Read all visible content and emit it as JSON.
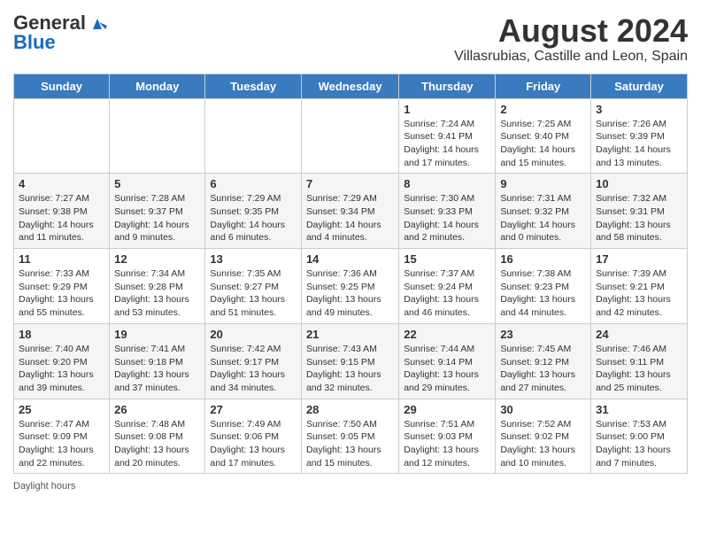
{
  "logo": {
    "general": "General",
    "blue": "Blue"
  },
  "title": "August 2024",
  "subtitle": "Villasrubias, Castille and Leon, Spain",
  "days_of_week": [
    "Sunday",
    "Monday",
    "Tuesday",
    "Wednesday",
    "Thursday",
    "Friday",
    "Saturday"
  ],
  "weeks": [
    [
      {
        "day": "",
        "info": ""
      },
      {
        "day": "",
        "info": ""
      },
      {
        "day": "",
        "info": ""
      },
      {
        "day": "",
        "info": ""
      },
      {
        "day": "1",
        "info": "Sunrise: 7:24 AM\nSunset: 9:41 PM\nDaylight: 14 hours and 17 minutes."
      },
      {
        "day": "2",
        "info": "Sunrise: 7:25 AM\nSunset: 9:40 PM\nDaylight: 14 hours and 15 minutes."
      },
      {
        "day": "3",
        "info": "Sunrise: 7:26 AM\nSunset: 9:39 PM\nDaylight: 14 hours and 13 minutes."
      }
    ],
    [
      {
        "day": "4",
        "info": "Sunrise: 7:27 AM\nSunset: 9:38 PM\nDaylight: 14 hours and 11 minutes."
      },
      {
        "day": "5",
        "info": "Sunrise: 7:28 AM\nSunset: 9:37 PM\nDaylight: 14 hours and 9 minutes."
      },
      {
        "day": "6",
        "info": "Sunrise: 7:29 AM\nSunset: 9:35 PM\nDaylight: 14 hours and 6 minutes."
      },
      {
        "day": "7",
        "info": "Sunrise: 7:29 AM\nSunset: 9:34 PM\nDaylight: 14 hours and 4 minutes."
      },
      {
        "day": "8",
        "info": "Sunrise: 7:30 AM\nSunset: 9:33 PM\nDaylight: 14 hours and 2 minutes."
      },
      {
        "day": "9",
        "info": "Sunrise: 7:31 AM\nSunset: 9:32 PM\nDaylight: 14 hours and 0 minutes."
      },
      {
        "day": "10",
        "info": "Sunrise: 7:32 AM\nSunset: 9:31 PM\nDaylight: 13 hours and 58 minutes."
      }
    ],
    [
      {
        "day": "11",
        "info": "Sunrise: 7:33 AM\nSunset: 9:29 PM\nDaylight: 13 hours and 55 minutes."
      },
      {
        "day": "12",
        "info": "Sunrise: 7:34 AM\nSunset: 9:28 PM\nDaylight: 13 hours and 53 minutes."
      },
      {
        "day": "13",
        "info": "Sunrise: 7:35 AM\nSunset: 9:27 PM\nDaylight: 13 hours and 51 minutes."
      },
      {
        "day": "14",
        "info": "Sunrise: 7:36 AM\nSunset: 9:25 PM\nDaylight: 13 hours and 49 minutes."
      },
      {
        "day": "15",
        "info": "Sunrise: 7:37 AM\nSunset: 9:24 PM\nDaylight: 13 hours and 46 minutes."
      },
      {
        "day": "16",
        "info": "Sunrise: 7:38 AM\nSunset: 9:23 PM\nDaylight: 13 hours and 44 minutes."
      },
      {
        "day": "17",
        "info": "Sunrise: 7:39 AM\nSunset: 9:21 PM\nDaylight: 13 hours and 42 minutes."
      }
    ],
    [
      {
        "day": "18",
        "info": "Sunrise: 7:40 AM\nSunset: 9:20 PM\nDaylight: 13 hours and 39 minutes."
      },
      {
        "day": "19",
        "info": "Sunrise: 7:41 AM\nSunset: 9:18 PM\nDaylight: 13 hours and 37 minutes."
      },
      {
        "day": "20",
        "info": "Sunrise: 7:42 AM\nSunset: 9:17 PM\nDaylight: 13 hours and 34 minutes."
      },
      {
        "day": "21",
        "info": "Sunrise: 7:43 AM\nSunset: 9:15 PM\nDaylight: 13 hours and 32 minutes."
      },
      {
        "day": "22",
        "info": "Sunrise: 7:44 AM\nSunset: 9:14 PM\nDaylight: 13 hours and 29 minutes."
      },
      {
        "day": "23",
        "info": "Sunrise: 7:45 AM\nSunset: 9:12 PM\nDaylight: 13 hours and 27 minutes."
      },
      {
        "day": "24",
        "info": "Sunrise: 7:46 AM\nSunset: 9:11 PM\nDaylight: 13 hours and 25 minutes."
      }
    ],
    [
      {
        "day": "25",
        "info": "Sunrise: 7:47 AM\nSunset: 9:09 PM\nDaylight: 13 hours and 22 minutes."
      },
      {
        "day": "26",
        "info": "Sunrise: 7:48 AM\nSunset: 9:08 PM\nDaylight: 13 hours and 20 minutes."
      },
      {
        "day": "27",
        "info": "Sunrise: 7:49 AM\nSunset: 9:06 PM\nDaylight: 13 hours and 17 minutes."
      },
      {
        "day": "28",
        "info": "Sunrise: 7:50 AM\nSunset: 9:05 PM\nDaylight: 13 hours and 15 minutes."
      },
      {
        "day": "29",
        "info": "Sunrise: 7:51 AM\nSunset: 9:03 PM\nDaylight: 13 hours and 12 minutes."
      },
      {
        "day": "30",
        "info": "Sunrise: 7:52 AM\nSunset: 9:02 PM\nDaylight: 13 hours and 10 minutes."
      },
      {
        "day": "31",
        "info": "Sunrise: 7:53 AM\nSunset: 9:00 PM\nDaylight: 13 hours and 7 minutes."
      }
    ]
  ],
  "footer": "Daylight hours"
}
